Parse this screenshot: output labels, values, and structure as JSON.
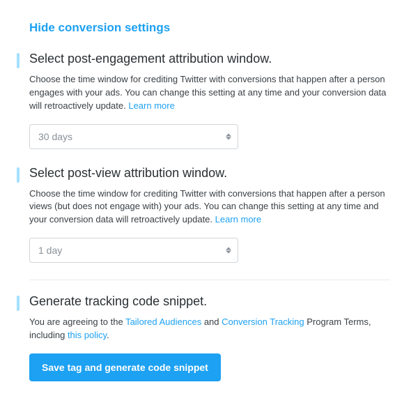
{
  "header": {
    "hide_link": "Hide conversion settings"
  },
  "sections": {
    "engagement": {
      "heading": "Select post-engagement attribution window.",
      "desc_pre": "Choose the time window for crediting Twitter with conversions that happen after a person engages with your ads. You can change this setting at any time and your conversion data will retroactively update. ",
      "learn_more": "Learn more",
      "select_value": "30 days"
    },
    "view": {
      "heading": "Select post-view attribution window.",
      "desc_pre": "Choose the time window for crediting Twitter with conversions that happen after a person views (but does not engage with) your ads. You can change this setting at any time and your conversion data will retroactively update. ",
      "learn_more": "Learn more",
      "select_value": "1 day"
    },
    "generate": {
      "heading": "Generate tracking code snippet.",
      "terms_pre": "You are agreeing to the ",
      "link1": "Tailored Audiences",
      "mid1": " and ",
      "link2": "Conversion Tracking",
      "mid2": " Program Terms, including ",
      "link3": "this policy",
      "terms_post": ".",
      "button_label": "Save tag and generate code snippet"
    }
  }
}
